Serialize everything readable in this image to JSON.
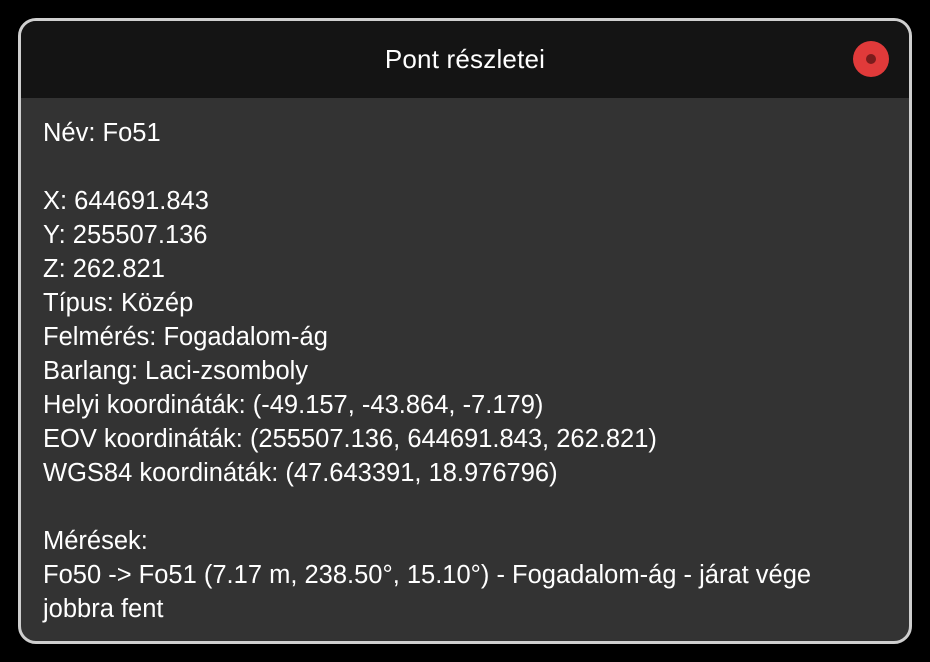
{
  "dialog": {
    "title": "Pont részletei",
    "close_color": "#e03a3a"
  },
  "details": {
    "name": "Név: Fo51",
    "x": "X: 644691.843",
    "y": "Y: 255507.136",
    "z": "Z: 262.821",
    "type": "Típus: Közép",
    "survey": "Felmérés: Fogadalom-ág",
    "cave": "Barlang: Laci-zsomboly",
    "local_coords": "Helyi koordináták: (-49.157, -43.864, -7.179)",
    "eov_coords": "EOV koordináták: (255507.136, 644691.843, 262.821)",
    "wgs84_coords": "WGS84 koordináták: (47.643391, 18.976796)"
  },
  "measurements": {
    "heading": "Mérések:",
    "items": [
      "Fo50 -> Fo51 (7.17 m, 238.50°, 15.10°) - Fogadalom-ág - járat vége jobbra fent"
    ]
  }
}
